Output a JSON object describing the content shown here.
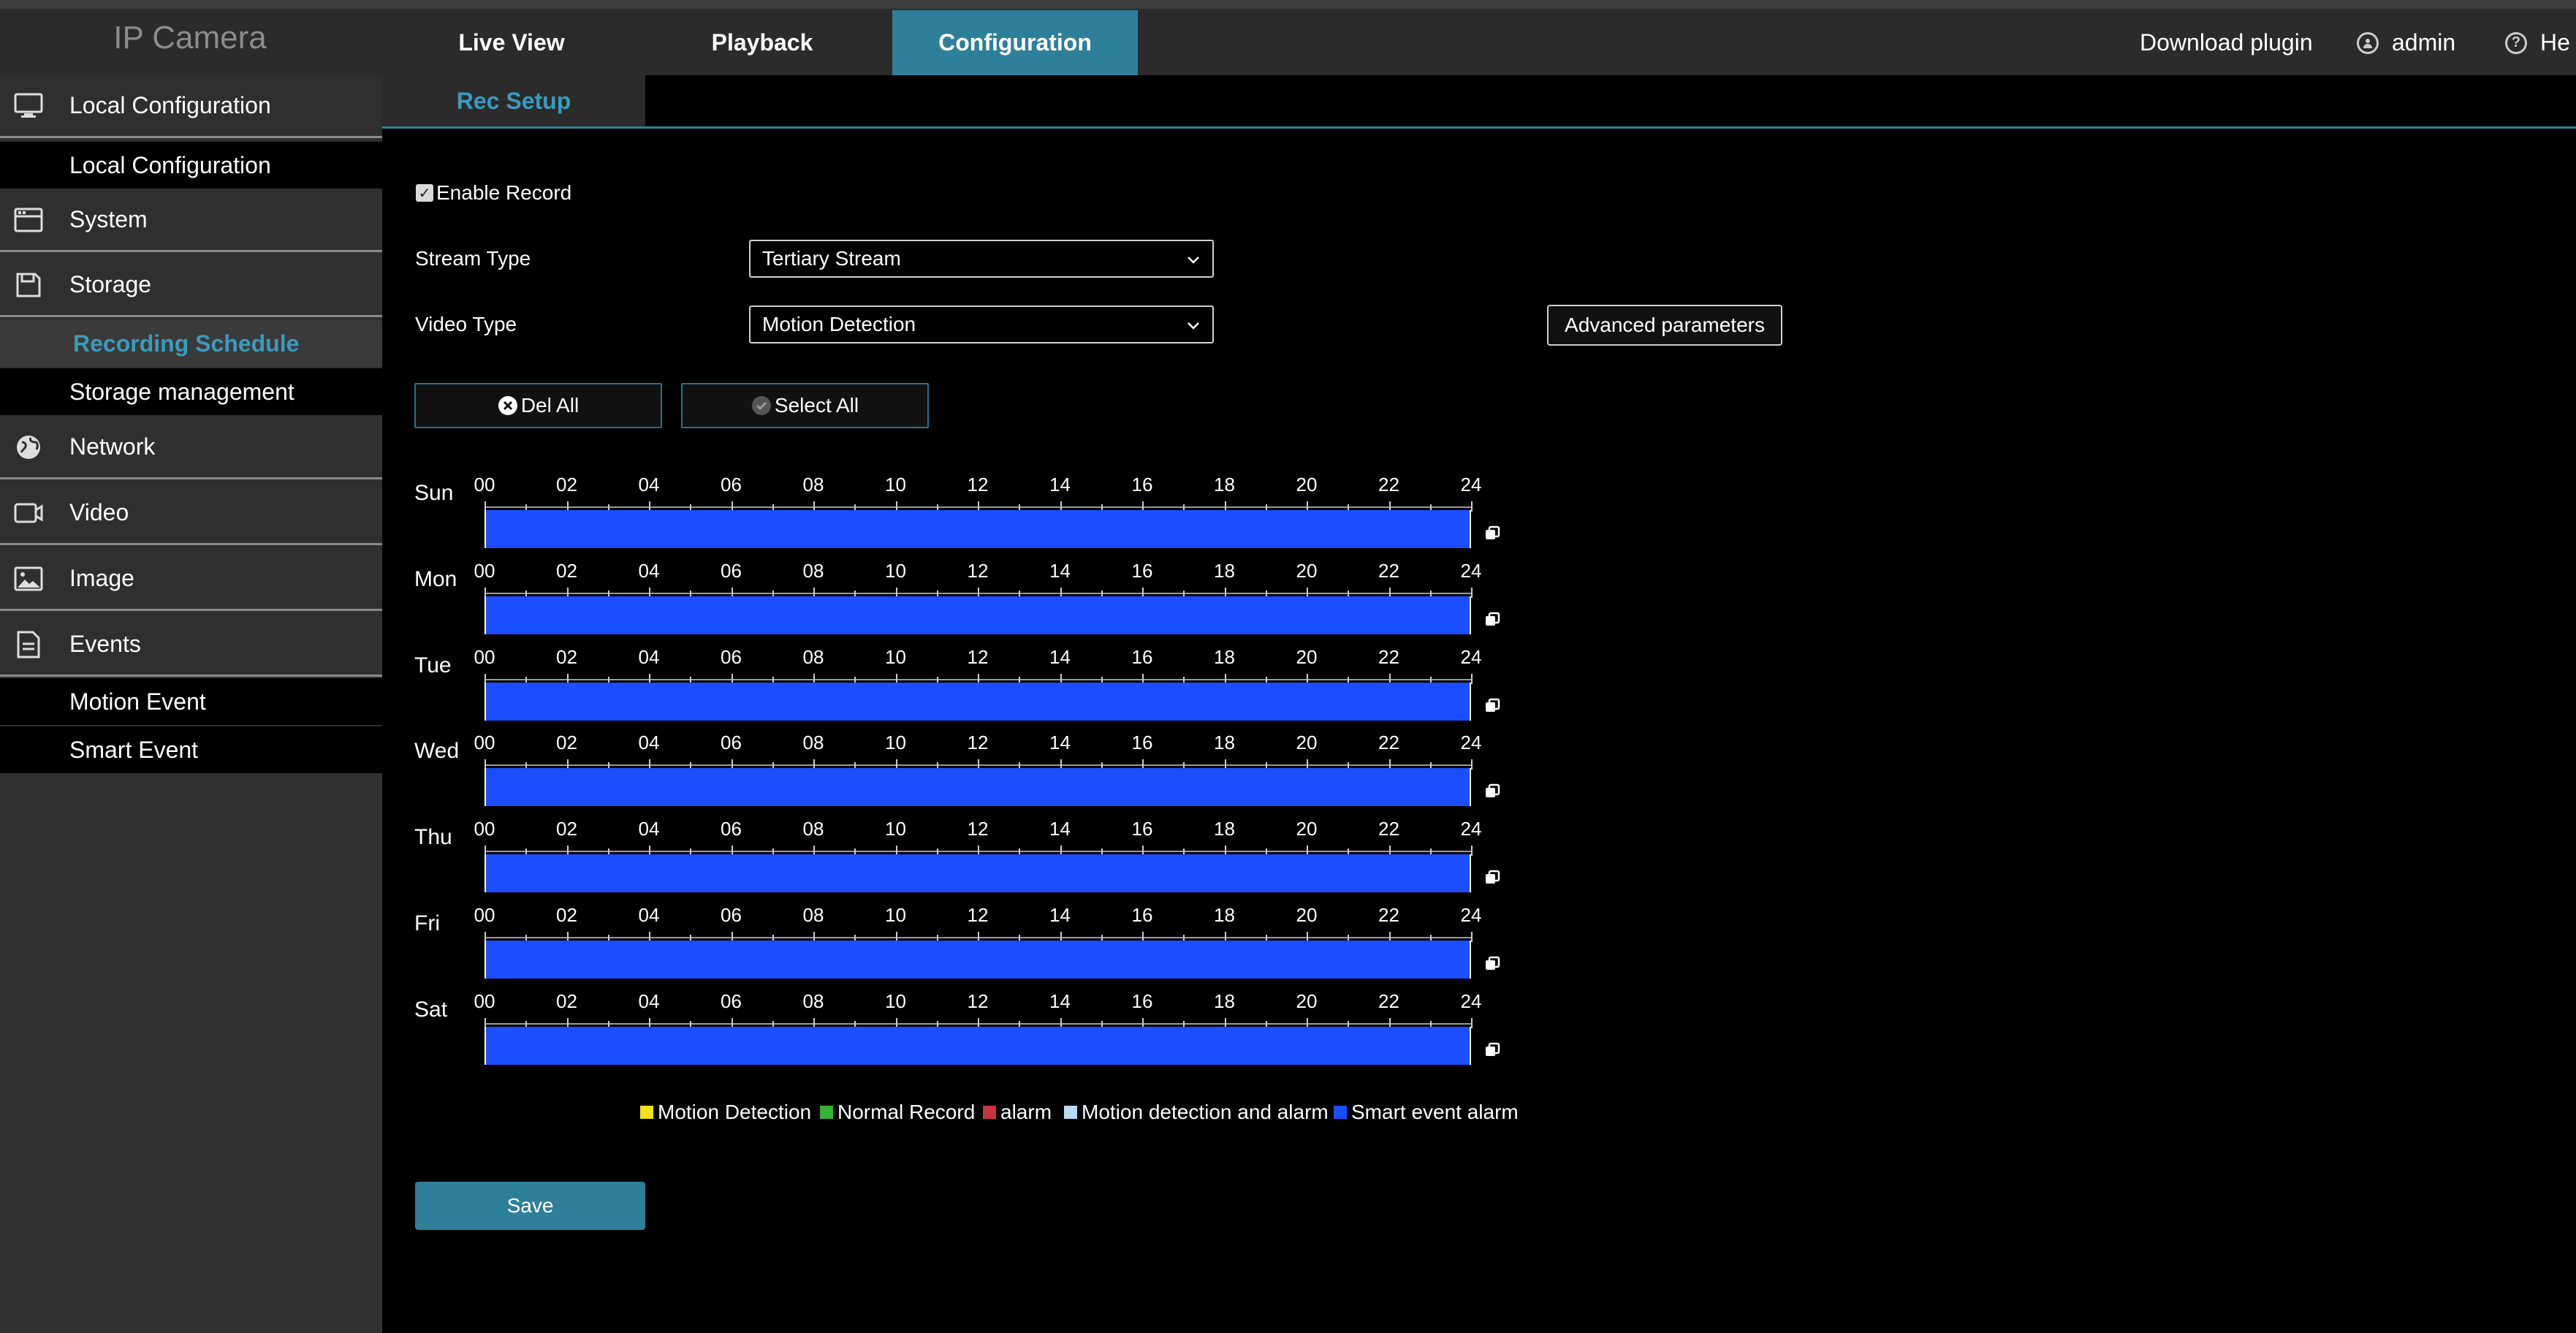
{
  "app": {
    "brand": "IP Camera"
  },
  "nav": {
    "tabs": [
      {
        "label": "Live View"
      },
      {
        "label": "Playback"
      },
      {
        "label": "Configuration"
      }
    ],
    "download_plugin": "Download plugin",
    "user": "admin",
    "help": "He"
  },
  "sidebar": {
    "local_configuration": "Local Configuration",
    "local_configuration_sub": "Local Configuration",
    "system": "System",
    "storage": "Storage",
    "recording_schedule": "Recording Schedule",
    "storage_management": "Storage management",
    "network": "Network",
    "video": "Video",
    "image": "Image",
    "events": "Events",
    "motion_event": "Motion Event",
    "smart_event": "Smart Event"
  },
  "subtab": {
    "label": "Rec Setup"
  },
  "form": {
    "enable_record_label": "Enable Record",
    "enable_record_checked": true,
    "stream_type_label": "Stream Type",
    "stream_type_value": "Tertiary Stream",
    "video_type_label": "Video Type",
    "video_type_value": "Motion Detection",
    "advanced_button": "Advanced parameters",
    "del_all_button": "Del All",
    "select_all_button": "Select All",
    "save_button": "Save"
  },
  "schedule": {
    "days": [
      "Sun",
      "Mon",
      "Tue",
      "Wed",
      "Thu",
      "Fri",
      "Sat"
    ],
    "hour_labels": [
      "00",
      "02",
      "04",
      "06",
      "08",
      "10",
      "12",
      "14",
      "16",
      "18",
      "20",
      "22",
      "24"
    ],
    "fill_color": "#1a4eff",
    "fill_start_hour": 0,
    "fill_end_hour": 24
  },
  "legend": [
    {
      "label": "Motion Detection",
      "color": "#f2e01c"
    },
    {
      "label": "Normal Record",
      "color": "#34b233"
    },
    {
      "label": "alarm",
      "color": "#c9353a"
    },
    {
      "label": "Motion detection and alarm",
      "color": "#b7d9f2"
    },
    {
      "label": "Smart event alarm",
      "color": "#1a4eff"
    }
  ],
  "colors": {
    "accent": "#2e7f99",
    "accent_text": "#3a9bbd",
    "sidebar_bg": "#2f2f2f",
    "topbar_bg": "#2b2b2b"
  }
}
